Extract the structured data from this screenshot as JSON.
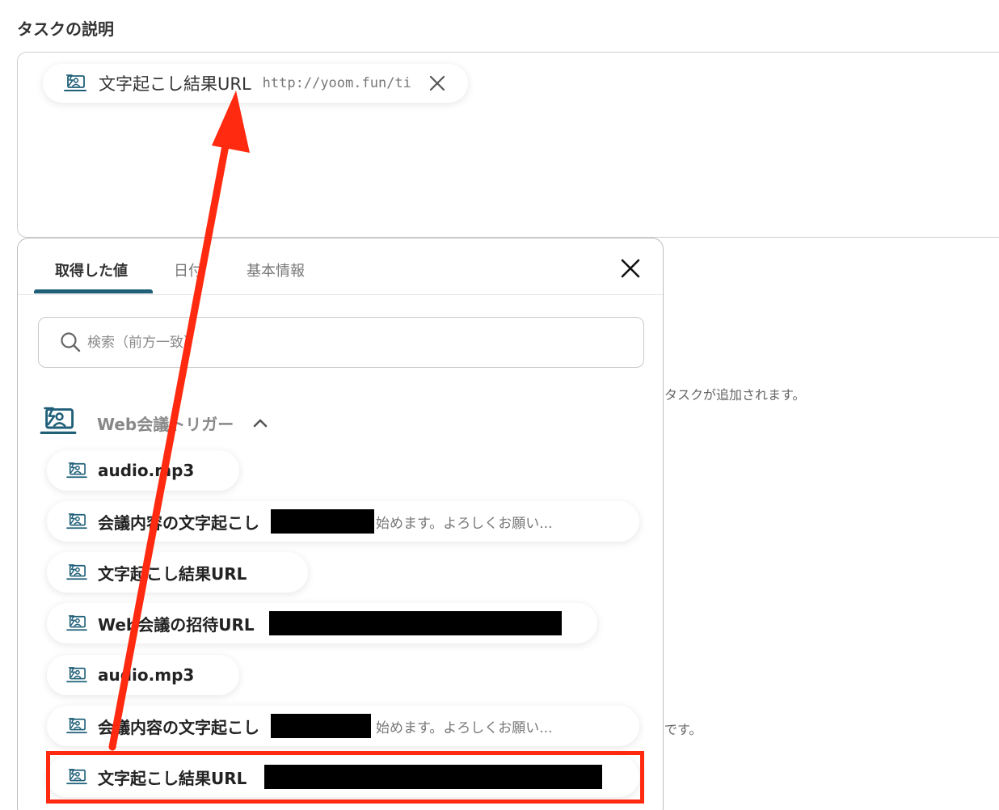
{
  "section": {
    "title": "タスクの説明"
  },
  "description_field": {
    "chip": {
      "label": "文字起こし結果URL",
      "value": "http://yoom.fun/ti..."
    }
  },
  "picker": {
    "tabs": [
      {
        "label": "取得した値",
        "active": true
      },
      {
        "label": "日付",
        "active": false
      },
      {
        "label": "基本情報",
        "active": false
      }
    ],
    "search_placeholder": "検索（前方一致）",
    "group": {
      "title": "Web会議トリガー",
      "expanded": true
    },
    "items": [
      {
        "label": "audio.mp3",
        "value": ""
      },
      {
        "label": "会議内容の文字起こし",
        "value": "始めます。よろしくお願い..."
      },
      {
        "label": "文字起こし結果URL",
        "value": ""
      },
      {
        "label": "Web会議の招待URL",
        "value": ""
      },
      {
        "label": "audio.mp3",
        "value": ""
      },
      {
        "label": "会議内容の文字起こし",
        "value": "始めます。よろしくお願い..."
      },
      {
        "label": "文字起こし結果URL",
        "value": ""
      }
    ]
  },
  "background": {
    "hint1": "タスクが追加されます。",
    "hint2": "です。"
  },
  "colors": {
    "accent": "#1f5f78",
    "annotation": "#ff2a10",
    "redaction": "#000000"
  }
}
